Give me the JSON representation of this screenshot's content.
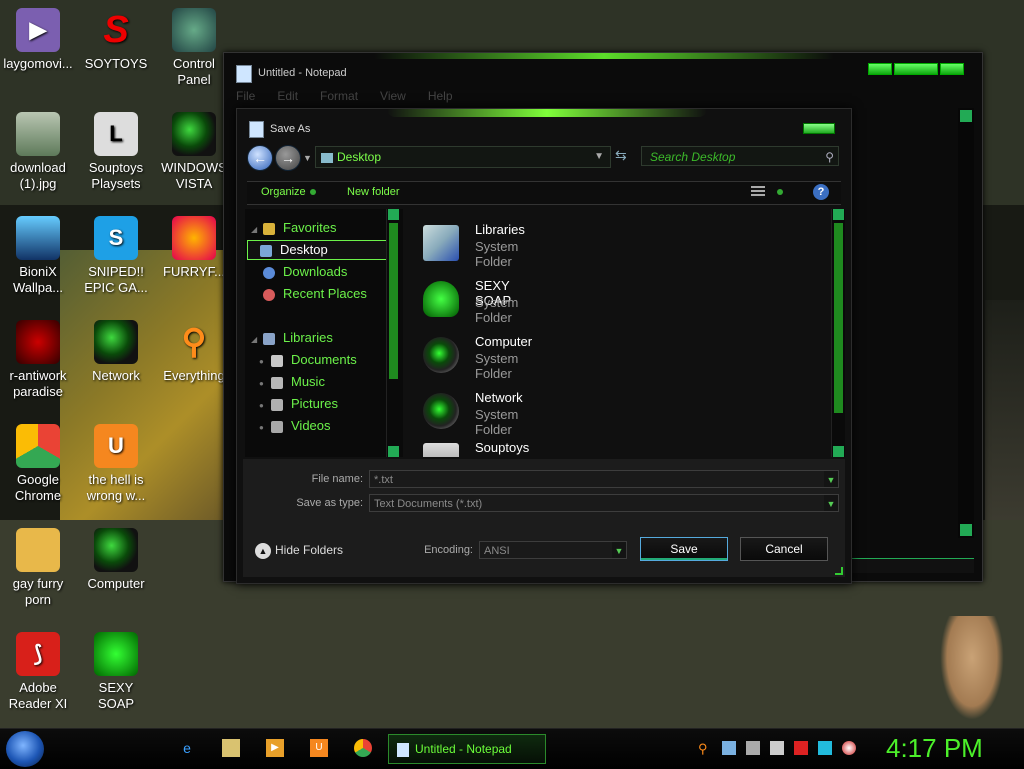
{
  "desktop": {
    "icons": [
      {
        "label": "laygomovi..."
      },
      {
        "label": "SOYTOYS"
      },
      {
        "label": "Control\nPanel"
      },
      {
        "label": "download\n(1).jpg"
      },
      {
        "label": "Souptoys\nPlaysets"
      },
      {
        "label": "WINDOWS\nVISTA"
      },
      {
        "label": "BioniX\nWallpa..."
      },
      {
        "label": "SNIPED!!\nEPIC GA..."
      },
      {
        "label": "FURRYF..."
      },
      {
        "label": "r-antiwork\nparadise"
      },
      {
        "label": "Network"
      },
      {
        "label": "Everything"
      },
      {
        "label": "Google\nChrome"
      },
      {
        "label": "the hell is\nwrong w..."
      },
      {
        "label": "gay furry\nporn"
      },
      {
        "label": "Computer"
      },
      {
        "label": "Adobe\nReader XI"
      },
      {
        "label": "SEXY\nSOAP"
      }
    ]
  },
  "notepad": {
    "title": "Untitled - Notepad",
    "menu": [
      "File",
      "Edit",
      "Format",
      "View",
      "Help"
    ]
  },
  "save_dialog": {
    "title": "Save As",
    "address": "Desktop",
    "search_placeholder": "Search Desktop",
    "toolbar": {
      "organize": "Organize",
      "new_folder": "New folder",
      "help": "?"
    },
    "nav": {
      "favorites_label": "Favorites",
      "favorites": [
        "Desktop",
        "Downloads",
        "Recent Places"
      ],
      "libraries_label": "Libraries",
      "libraries": [
        "Documents",
        "Music",
        "Pictures",
        "Videos"
      ]
    },
    "files": [
      {
        "name": "Libraries",
        "type": "System Folder"
      },
      {
        "name": "SEXY SOAP",
        "type": "System Folder"
      },
      {
        "name": "Computer",
        "type": "System Folder"
      },
      {
        "name": "Network",
        "type": "System Folder"
      },
      {
        "name": "Souptoys Playsets",
        "type": ""
      }
    ],
    "file_name_label": "File name:",
    "file_name_value": "*.txt",
    "save_type_label": "Save as type:",
    "save_type_value": "Text Documents (*.txt)",
    "hide_folders": "Hide Folders",
    "encoding_label": "Encoding:",
    "encoding_value": "ANSI",
    "save_button": "Save",
    "cancel_button": "Cancel"
  },
  "taskbar": {
    "active_task": "Untitled - Notepad",
    "clock": "4:17 PM"
  },
  "colors": {
    "accent": "#6cf24a",
    "window_bg": "#101010"
  }
}
